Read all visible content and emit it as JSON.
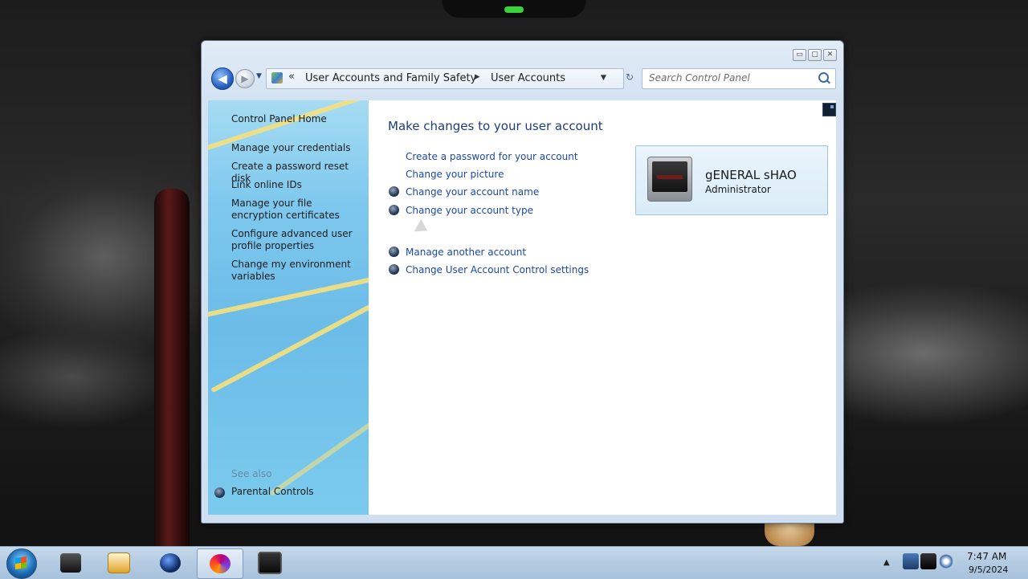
{
  "window": {
    "controls": {
      "minimize": "▭",
      "maximize": "▢",
      "close": "✕"
    }
  },
  "address_bar": {
    "back_icon": "back-arrow-icon",
    "forward_icon": "forward-arrow-icon",
    "overflow": "«",
    "breadcrumb": [
      "User Accounts and Family Safety",
      "User Accounts"
    ],
    "separator": "▸",
    "refresh": "↻",
    "search_placeholder": "Search Control Panel"
  },
  "left_pane": {
    "home": "Control Panel Home",
    "links": [
      "Manage your credentials",
      "Create a password reset disk",
      "Link online IDs",
      "Manage your file encryption certificates",
      "Configure advanced user profile properties",
      "Change my environment variables"
    ],
    "see_also_label": "See also",
    "see_also_links": [
      "Parental Controls"
    ]
  },
  "main": {
    "title": "Make changes to your user account",
    "tasks": [
      {
        "label": "Create a password for your account",
        "shield": false
      },
      {
        "label": "Change your picture",
        "shield": false
      },
      {
        "label": "Change your account name",
        "shield": true
      },
      {
        "label": "Change your account type",
        "shield": true
      },
      {
        "label": "Manage another account",
        "shield": true
      },
      {
        "label": "Change User Account Control settings",
        "shield": true
      }
    ],
    "account": {
      "name": "gENERAL sHAO",
      "role": "Administrator"
    }
  },
  "taskbar": {
    "items": [
      "file-explorer",
      "media-player",
      "globe",
      "firefox",
      "monitor"
    ],
    "active_item": "firefox",
    "tray_arrow": "▲",
    "time": "7:47 AM",
    "date": "9/5/2024"
  },
  "colors": {
    "link": "#1c49a3",
    "title": "#1e3d7b",
    "pane_blue": "#7ec8ee"
  }
}
